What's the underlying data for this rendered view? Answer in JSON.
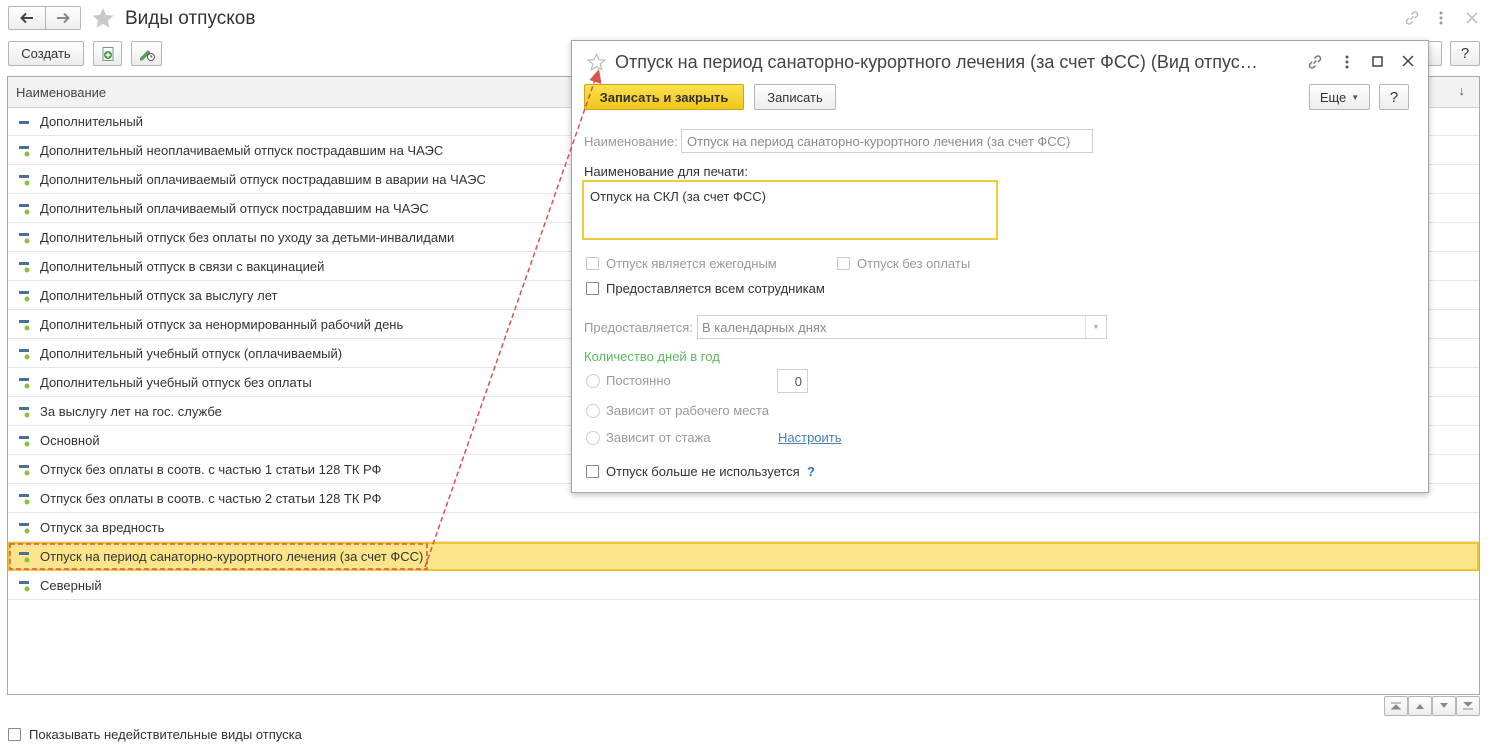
{
  "window": {
    "title": "Виды отпусков"
  },
  "toolbar": {
    "create_label": "Создать",
    "help_label": "?"
  },
  "list": {
    "header": "Наименование",
    "sort_glyph": "↓",
    "rows": [
      "Дополнительный",
      "Дополнительный неоплачиваемый отпуск пострадавшим на ЧАЭС",
      "Дополнительный оплачиваемый отпуск пострадавшим в аварии на ЧАЭС",
      "Дополнительный оплачиваемый отпуск пострадавшим на ЧАЭС",
      "Дополнительный отпуск без оплаты по уходу за детьми-инвалидами",
      "Дополнительный отпуск в связи с вакцинацией",
      "Дополнительный отпуск за выслугу лет",
      "Дополнительный отпуск за ненормированный рабочий день",
      "Дополнительный учебный отпуск (оплачиваемый)",
      "Дополнительный учебный отпуск без оплаты",
      "За выслугу лет на гос. службе",
      "Основной",
      "Отпуск без оплаты в соотв. с частью 1 статьи 128 ТК РФ",
      "Отпуск без оплаты в соотв. с частью 2 статьи 128 ТК РФ",
      "Отпуск за вредность",
      "Отпуск на период санаторно-курортного лечения (за счет ФСС)",
      "Северный"
    ]
  },
  "footer": {
    "show_invalid_label": "Показывать недействительные виды отпуска"
  },
  "dialog": {
    "title": "Отпуск на период санаторно-курортного лечения (за счет ФСС) (Вид отпус…",
    "save_close_label": "Записать и закрыть",
    "save_label": "Записать",
    "more_label": "Еще",
    "help_label": "?",
    "name_label": "Наименование:",
    "name_value": "Отпуск на период санаторно-курортного лечения (за счет ФСС)",
    "print_name_label": "Наименование для печати:",
    "print_name_value": "Отпуск на СКЛ (за счет ФСС)",
    "annual_label": "Отпуск является ежегодным",
    "unpaid_label": "Отпуск без оплаты",
    "all_employees_label": "Предоставляется всем сотрудникам",
    "provided_label": "Предоставляется:",
    "provided_value": "В календарных днях",
    "days_per_year_label": "Количество дней в год",
    "constant_label": "Постоянно",
    "constant_value": "0",
    "workplace_label": "Зависит от рабочего места",
    "seniority_label": "Зависит от стажа",
    "configure_link": "Настроить",
    "not_used_label": "Отпуск больше не используется",
    "not_used_help": "?"
  },
  "colors": {
    "selected_row": "#fbe58a",
    "primary_button": "#f6d32a",
    "arrow": "#d9534f",
    "link": "#4a7fb5",
    "group_title": "#5cb85c"
  }
}
